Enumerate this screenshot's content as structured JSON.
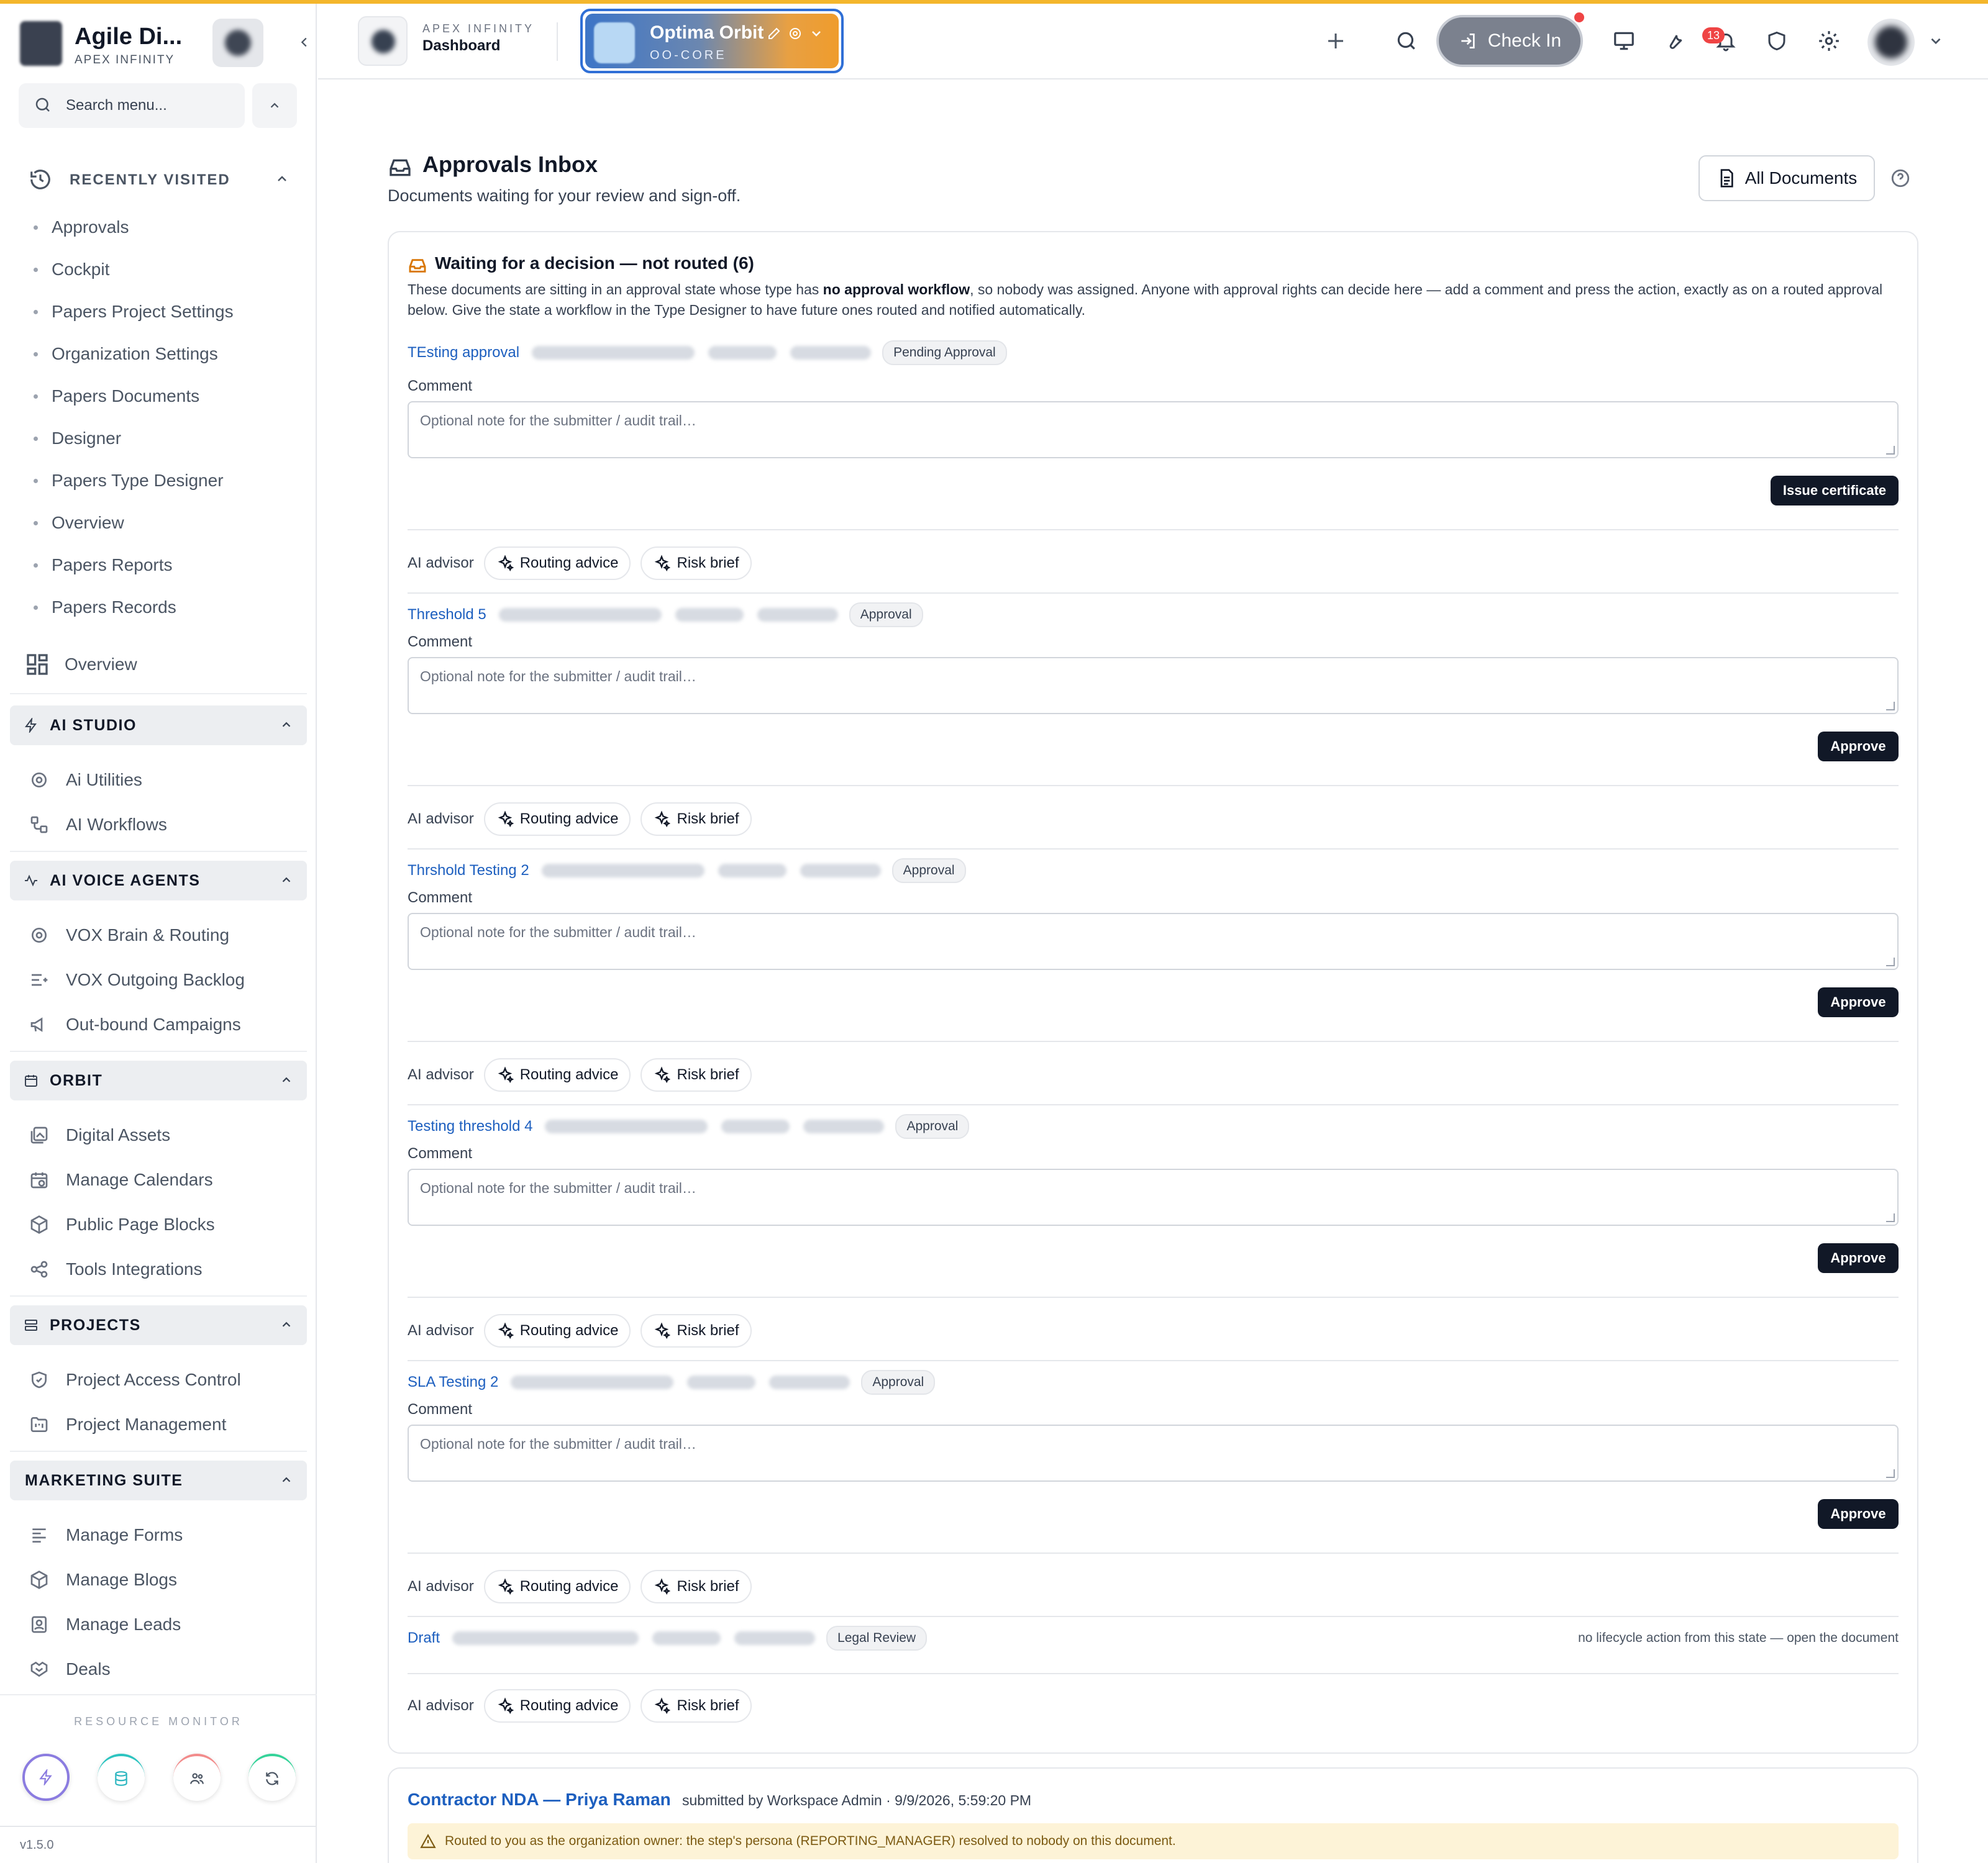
{
  "brand": {
    "name": "Agile Di...",
    "sub": "APEX INFINITY"
  },
  "sidebar": {
    "search_placeholder": "Search menu...",
    "recent_title": "RECENTLY VISITED",
    "recent": [
      "Approvals",
      "Cockpit",
      "Papers Project Settings",
      "Organization Settings",
      "Papers Documents",
      "Designer",
      "Papers Type Designer",
      "Overview",
      "Papers Reports",
      "Papers Records"
    ],
    "overview": "Overview",
    "sections": {
      "ai_studio": {
        "title": "AI STUDIO",
        "items": [
          "Ai Utilities",
          "AI Workflows"
        ]
      },
      "ai_voice": {
        "title": "AI VOICE AGENTS",
        "items": [
          "VOX Brain & Routing",
          "VOX Outgoing Backlog",
          "Out-bound Campaigns"
        ]
      },
      "orbit": {
        "title": "ORBIT",
        "items": [
          "Digital Assets",
          "Manage Calendars",
          "Public Page Blocks",
          "Tools Integrations"
        ]
      },
      "projects": {
        "title": "PROJECTS",
        "items": [
          "Project Access Control",
          "Project Management"
        ]
      },
      "marketing": {
        "title": "MARKETING SUITE",
        "items": [
          "Manage Forms",
          "Manage Blogs",
          "Manage Leads",
          "Deals"
        ]
      }
    },
    "resource_monitor": "RESOURCE MONITOR",
    "version": "v1.5.0"
  },
  "topbar": {
    "workspace_sub": "APEX INFINITY",
    "workspace_name": "Dashboard",
    "org_name": "Optima Orbit",
    "org_sub": "OO-CORE",
    "checkin": "Check In",
    "notifications": "13",
    "colors": {
      "accent_top": "#f4b62c",
      "org_gradient_start": "#3d75c7",
      "org_gradient_end": "#ef9c2c",
      "badge": "#ef4444"
    }
  },
  "page": {
    "title": "Approvals Inbox",
    "subtitle": "Documents waiting for your review and sign-off.",
    "all_documents": "All Documents"
  },
  "waiting": {
    "title": "Waiting for a decision — not routed (6)",
    "desc_1": "These documents are sitting in an approval state whose type has ",
    "desc_bold": "no approval workflow",
    "desc_2": ", so nobody was assigned. Anyone with approval rights can decide here — add a comment and press the action, exactly as on a routed approval below. Give the state a workflow in the Type Designer to have future ones routed and notified automatically.",
    "comment_label": "Comment",
    "comment_placeholder": "Optional note for the submitter / audit trail…",
    "advisor_label": "AI advisor",
    "routing_advice": "Routing advice",
    "risk_brief": "Risk brief",
    "documents": [
      {
        "title": "TEsting approval",
        "status": "Pending Approval",
        "action": "Issue certificate"
      },
      {
        "title": "Threshold 5",
        "status": "Approval",
        "action": "Approve"
      },
      {
        "title": "Thrshold Testing 2",
        "status": "Approval",
        "action": "Approve"
      },
      {
        "title": "Testing threshold 4",
        "status": "Approval",
        "action": "Approve"
      },
      {
        "title": "SLA Testing 2",
        "status": "Approval",
        "action": "Approve"
      },
      {
        "title": "Draft",
        "status": "Legal Review",
        "note": "no lifecycle action from this state — open the document"
      }
    ]
  },
  "routed": {
    "title": "Contractor NDA — Priya Raman",
    "meta": "submitted by Workspace Admin · 9/9/2026, 5:59:20 PM",
    "warning": "Routed to you as the organization owner: the step's persona (REPORTING_MANAGER) resolved to nobody on this document."
  }
}
